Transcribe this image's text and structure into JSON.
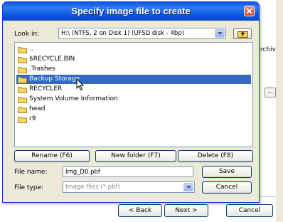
{
  "background": {
    "archive_label": "rchive",
    "dots_button": "...",
    "back_button": "< Back",
    "back_mnemonic": "B",
    "next_button": "Next >",
    "next_mnemonic": "N",
    "cancel_button": "Cancel",
    "cancel_mnemonic": "C"
  },
  "dialog": {
    "title": "Specify image file to create",
    "look_in_label": "Look in:",
    "look_in_value": "H:\\  (NTFS, 2 on Disk 1) (UFSD disk - 4bp)",
    "files": [
      {
        "name": ".."
      },
      {
        "name": "$RECYCLE.BIN"
      },
      {
        "name": ".Trashes"
      },
      {
        "name": "Backup Storage",
        "selected": true
      },
      {
        "name": "RECYCLER"
      },
      {
        "name": "System Volume Information"
      },
      {
        "name": "head"
      },
      {
        "name": "r9"
      }
    ],
    "rename_button": "Rename (F6)",
    "new_folder_button": "New folder (F7)",
    "delete_button": "Delete (F8)",
    "file_name_label": "File name:",
    "file_name_value": "Img_D0.pbf",
    "save_button": "Save",
    "file_type_label": "File type:",
    "file_type_value": "Image files (*.pbf)",
    "cancel_button": "Cancel",
    "cancel_mnemonic": "C"
  },
  "colors": {
    "titlebar": "#0a58e0",
    "selection": "#316ac5",
    "dialog_bg": "#ece9d8"
  }
}
